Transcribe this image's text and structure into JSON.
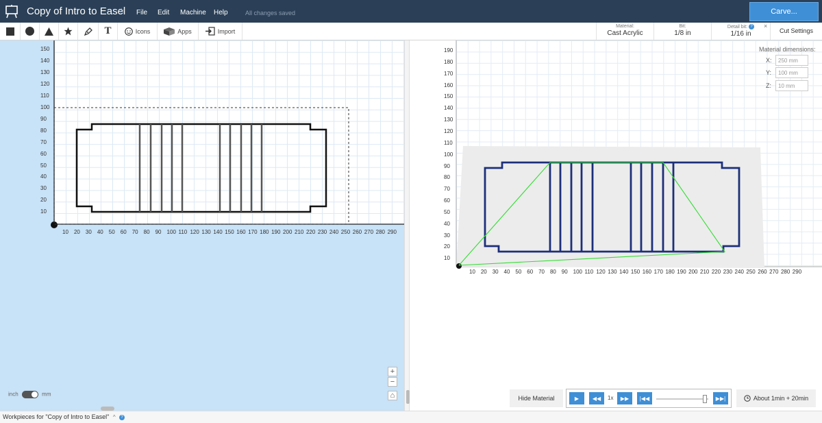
{
  "header": {
    "title": "Copy of Intro to Easel",
    "star": "☆",
    "menu": [
      "File",
      "Edit",
      "Machine",
      "Help"
    ],
    "status": "All changes saved",
    "carve_label": "Carve...",
    "bg_color": "#2b4057",
    "accent": "#3f8fd6"
  },
  "toolbar": {
    "shapes": [
      "square-icon",
      "circle-icon",
      "triangle-icon",
      "star-icon",
      "pen-icon",
      "text-icon"
    ],
    "text_glyph": "T",
    "icons_label": "Icons",
    "apps_label": "Apps",
    "import_label": "Import",
    "material": {
      "label": "Material:",
      "value": "Cast Acrylic"
    },
    "bit": {
      "label": "Bit:",
      "value": "1/8 in"
    },
    "detail_bit": {
      "label": "Detail bit:",
      "value": "1/16 in",
      "help": "?"
    },
    "close": "×",
    "cut_settings_label": "Cut Settings"
  },
  "design_canvas": {
    "y_ticks": [
      "150",
      "140",
      "130",
      "120",
      "110",
      "100",
      "90",
      "80",
      "70",
      "60",
      "50",
      "40",
      "30",
      "20",
      "10"
    ],
    "x_ticks": [
      "10",
      "20",
      "30",
      "40",
      "50",
      "60",
      "70",
      "80",
      "90",
      "100",
      "110",
      "120",
      "130",
      "140",
      "150",
      "160",
      "170",
      "180",
      "190",
      "200",
      "210",
      "220",
      "230",
      "240",
      "250",
      "260",
      "270",
      "280",
      "290"
    ],
    "zoom_in": "+",
    "zoom_out": "−",
    "home": "⌂"
  },
  "preview": {
    "y_ticks": [
      "190",
      "180",
      "170",
      "160",
      "150",
      "140",
      "130",
      "120",
      "110",
      "100",
      "90",
      "80",
      "70",
      "60",
      "50",
      "40",
      "30",
      "20",
      "10"
    ],
    "x_ticks": [
      "10",
      "20",
      "30",
      "40",
      "50",
      "60",
      "70",
      "80",
      "90",
      "100",
      "110",
      "120",
      "130",
      "140",
      "150",
      "160",
      "170",
      "180",
      "190",
      "200",
      "210",
      "220",
      "230",
      "240",
      "250",
      "260",
      "270",
      "280",
      "290"
    ],
    "material_dimensions": {
      "title": "Material dimensions:",
      "x_label": "X:",
      "x_value": "250 mm",
      "y_label": "Y:",
      "y_value": "100 mm",
      "z_label": "Z:",
      "z_value": "10 mm"
    },
    "hide_material_label": "Hide Material",
    "speed_label": "1x",
    "duration_label": "About 1min + 20min"
  },
  "units": {
    "left": "inch",
    "right": "mm",
    "selected": "mm"
  },
  "bottom": {
    "workpieces_label": "Workpieces for \"Copy of Intro to Easel\"",
    "caret": "^",
    "help": "?"
  }
}
